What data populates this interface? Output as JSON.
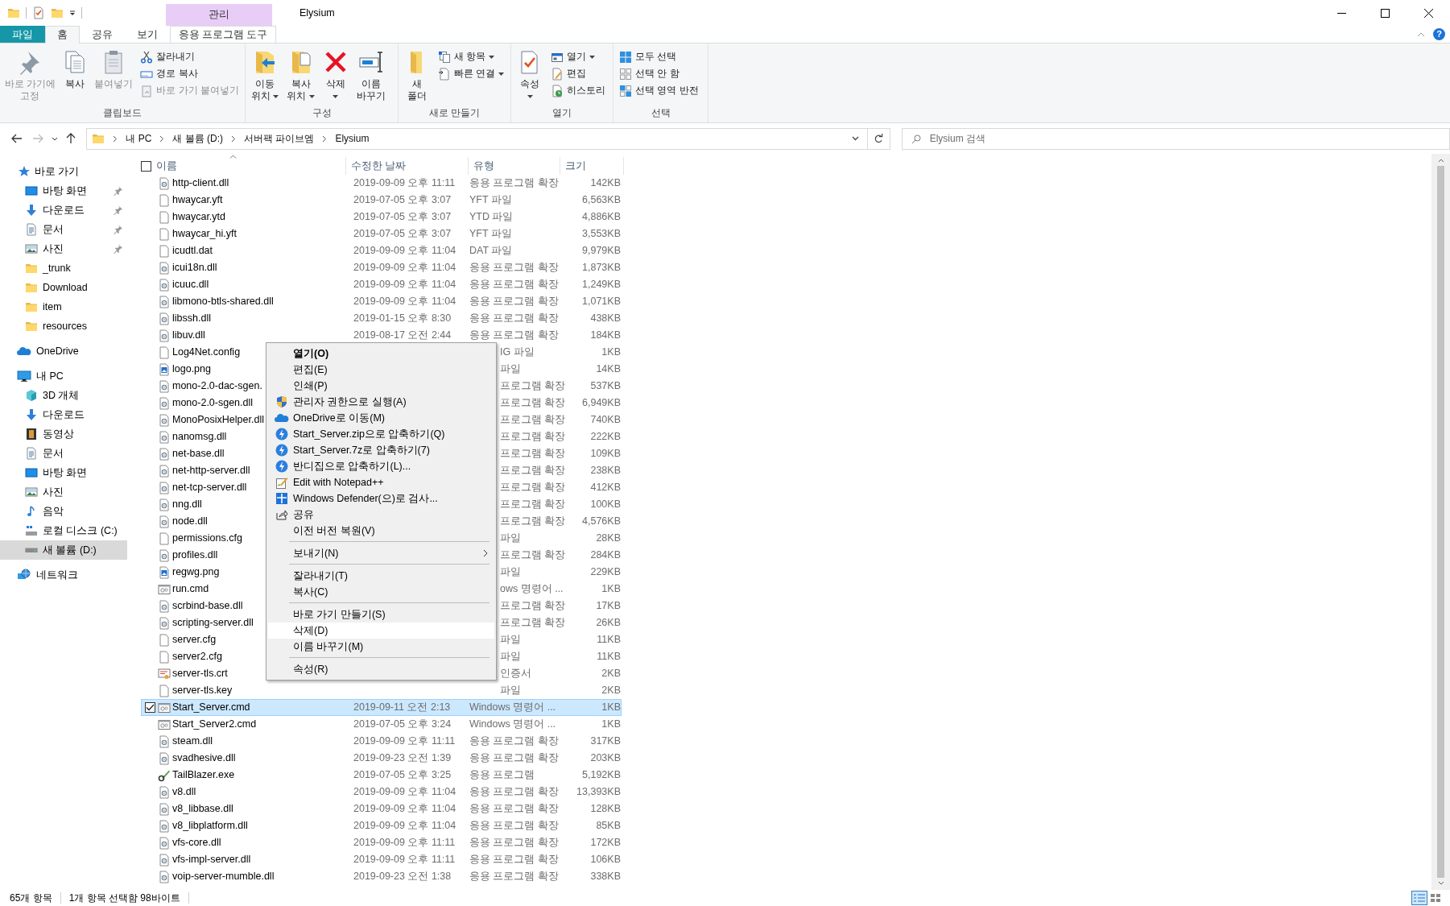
{
  "window": {
    "title": "Elysium",
    "context_group": "관리"
  },
  "ribbon_tabs": [
    {
      "label": "파일",
      "kind": "file",
      "selected": false
    },
    {
      "label": "홈",
      "kind": "tab",
      "selected": true
    },
    {
      "label": "공유",
      "kind": "tab",
      "selected": false
    },
    {
      "label": "보기",
      "kind": "tab",
      "selected": false
    },
    {
      "label": "응용 프로그램 도구",
      "kind": "context",
      "selected": false
    }
  ],
  "help": "?",
  "ribbon_groups": [
    {
      "label": "클립보드",
      "large": [
        {
          "lines": [
            "바로 가기에",
            "고정"
          ],
          "disabled": true,
          "dropdown": false
        },
        {
          "lines": [
            "복사"
          ],
          "disabled": false,
          "dropdown": false
        },
        {
          "lines": [
            "붙여넣기"
          ],
          "disabled": true,
          "dropdown": false
        }
      ],
      "small": [
        {
          "label": "잘라내기",
          "disabled": false,
          "dropdown": false
        },
        {
          "label": "경로 복사",
          "disabled": false,
          "dropdown": false
        },
        {
          "label": "바로 가기 붙여넣기",
          "disabled": true,
          "dropdown": false
        }
      ]
    },
    {
      "label": "구성",
      "large": [
        {
          "lines": [
            "이동",
            "위치"
          ],
          "disabled": false,
          "dropdown": true
        },
        {
          "lines": [
            "복사",
            "위치"
          ],
          "disabled": false,
          "dropdown": true
        },
        {
          "lines": [
            "삭제"
          ],
          "disabled": false,
          "dropdown": true
        },
        {
          "lines": [
            "이름",
            "바꾸기"
          ],
          "disabled": false,
          "dropdown": false
        }
      ]
    },
    {
      "label": "새로 만들기",
      "large": [
        {
          "lines": [
            "새",
            "폴더"
          ],
          "disabled": false,
          "dropdown": false
        }
      ],
      "small": [
        {
          "label": "새 항목",
          "disabled": false,
          "dropdown": true
        },
        {
          "label": "빠른 연결",
          "disabled": false,
          "dropdown": true
        }
      ]
    },
    {
      "label": "열기",
      "large": [
        {
          "lines": [
            "속성"
          ],
          "disabled": false,
          "dropdown": true
        }
      ],
      "small": [
        {
          "label": "열기",
          "disabled": false,
          "dropdown": true
        },
        {
          "label": "편집",
          "disabled": false,
          "dropdown": false
        },
        {
          "label": "히스토리",
          "disabled": false,
          "dropdown": false
        }
      ]
    },
    {
      "label": "선택",
      "small": [
        {
          "label": "모두 선택",
          "disabled": false,
          "dropdown": false
        },
        {
          "label": "선택 안 함",
          "disabled": false,
          "dropdown": false
        },
        {
          "label": "선택 영역 반전",
          "disabled": false,
          "dropdown": false
        }
      ]
    }
  ],
  "nav_buttons": [
    {
      "kind": "back",
      "disabled": false
    },
    {
      "kind": "forward",
      "disabled": true
    },
    {
      "kind": "recent",
      "disabled": false
    },
    {
      "kind": "up",
      "disabled": false
    }
  ],
  "address": {
    "crumbs": [
      "내 PC",
      "새 볼륨 (D:)",
      "서버팩 파이브엠",
      "Elysium"
    ]
  },
  "search": {
    "placeholder": "Elysium 검색"
  },
  "sidebar": [
    {
      "label": "바로 가기",
      "kind": "quick",
      "selected": false,
      "children": [
        {
          "label": "바탕 화면",
          "kind": "desktop",
          "selected": false,
          "pinned": true
        },
        {
          "label": "다운로드",
          "kind": "download",
          "selected": false,
          "pinned": true
        },
        {
          "label": "문서",
          "kind": "documents",
          "selected": false,
          "pinned": true
        },
        {
          "label": "사진",
          "kind": "pictures",
          "selected": false,
          "pinned": true
        },
        {
          "label": "_trunk",
          "kind": "folder",
          "selected": false,
          "pinned": false
        },
        {
          "label": "Download",
          "kind": "folder",
          "selected": false,
          "pinned": false
        },
        {
          "label": "item",
          "kind": "folder",
          "selected": false,
          "pinned": false
        },
        {
          "label": "resources",
          "kind": "folder",
          "selected": false,
          "pinned": false
        }
      ]
    },
    {
      "label": "OneDrive",
      "kind": "onedrive",
      "selected": false
    },
    {
      "label": "내 PC",
      "kind": "pc",
      "selected": false,
      "children": [
        {
          "label": "3D 개체",
          "kind": "objects3d",
          "selected": false
        },
        {
          "label": "다운로드",
          "kind": "download",
          "selected": false
        },
        {
          "label": "동영상",
          "kind": "videos",
          "selected": false
        },
        {
          "label": "문서",
          "kind": "documents",
          "selected": false
        },
        {
          "label": "바탕 화면",
          "kind": "desktop",
          "selected": false
        },
        {
          "label": "사진",
          "kind": "pictures",
          "selected": false
        },
        {
          "label": "음악",
          "kind": "music",
          "selected": false
        },
        {
          "label": "로컬 디스크 (C:)",
          "kind": "localdisk",
          "selected": false
        },
        {
          "label": "새 볼륨 (D:)",
          "kind": "drive",
          "selected": true
        }
      ]
    },
    {
      "label": "네트워크",
      "kind": "network",
      "selected": false
    }
  ],
  "select_all": {
    "checked": false
  },
  "columns": [
    {
      "label": "이름",
      "sorted": true
    },
    {
      "label": "수정한 날짜",
      "sorted": false
    },
    {
      "label": "유형",
      "sorted": false
    },
    {
      "label": "크기",
      "sorted": false
    }
  ],
  "files": [
    {
      "name": "http-client.dll",
      "kind": "dll",
      "date": "2019-09-09 오후 11:11",
      "type": "응용 프로그램 확장",
      "size": "142KB",
      "selected": false
    },
    {
      "name": "hwaycar.yft",
      "kind": "file",
      "date": "2019-07-05 오후 3:07",
      "type": "YFT 파일",
      "size": "6,563KB",
      "selected": false
    },
    {
      "name": "hwaycar.ytd",
      "kind": "file",
      "date": "2019-07-05 오후 3:07",
      "type": "YTD 파일",
      "size": "4,886KB",
      "selected": false
    },
    {
      "name": "hwaycar_hi.yft",
      "kind": "file",
      "date": "2019-07-05 오후 3:07",
      "type": "YFT 파일",
      "size": "3,553KB",
      "selected": false
    },
    {
      "name": "icudtl.dat",
      "kind": "file",
      "date": "2019-09-09 오후 11:04",
      "type": "DAT 파일",
      "size": "9,979KB",
      "selected": false
    },
    {
      "name": "icui18n.dll",
      "kind": "dll",
      "date": "2019-09-09 오후 11:04",
      "type": "응용 프로그램 확장",
      "size": "1,873KB",
      "selected": false
    },
    {
      "name": "icuuc.dll",
      "kind": "dll",
      "date": "2019-09-09 오후 11:04",
      "type": "응용 프로그램 확장",
      "size": "1,249KB",
      "selected": false
    },
    {
      "name": "libmono-btls-shared.dll",
      "kind": "dll",
      "date": "2019-09-09 오후 11:04",
      "type": "응용 프로그램 확장",
      "size": "1,071KB",
      "selected": false
    },
    {
      "name": "libssh.dll",
      "kind": "dll",
      "date": "2019-01-15 오후 8:30",
      "type": "응용 프로그램 확장",
      "size": "438KB",
      "selected": false
    },
    {
      "name": "libuv.dll",
      "kind": "dll",
      "date": "2019-08-17 오전 2:44",
      "type": "응용 프로그램 확장",
      "size": "184KB",
      "selected": false
    },
    {
      "name": "Log4Net.config",
      "kind": "file",
      "type": "IG 파일",
      "size": "1KB",
      "selected": false
    },
    {
      "name": "logo.png",
      "kind": "image",
      "type": "파일",
      "size": "14KB",
      "selected": false
    },
    {
      "name": "mono-2.0-dac-sgen.",
      "kind": "dll",
      "type": "프로그램 확장",
      "size": "537KB",
      "selected": false
    },
    {
      "name": "mono-2.0-sgen.dll",
      "kind": "dll",
      "type": "프로그램 확장",
      "size": "6,949KB",
      "selected": false
    },
    {
      "name": "MonoPosixHelper.dll",
      "kind": "dll",
      "type": "프로그램 확장",
      "size": "740KB",
      "selected": false
    },
    {
      "name": "nanomsg.dll",
      "kind": "dll",
      "type": "프로그램 확장",
      "size": "222KB",
      "selected": false
    },
    {
      "name": "net-base.dll",
      "kind": "dll",
      "type": "프로그램 확장",
      "size": "109KB",
      "selected": false
    },
    {
      "name": "net-http-server.dll",
      "kind": "dll",
      "type": "프로그램 확장",
      "size": "238KB",
      "selected": false
    },
    {
      "name": "net-tcp-server.dll",
      "kind": "dll",
      "type": "프로그램 확장",
      "size": "412KB",
      "selected": false
    },
    {
      "name": "nng.dll",
      "kind": "dll",
      "type": "프로그램 확장",
      "size": "100KB",
      "selected": false
    },
    {
      "name": "node.dll",
      "kind": "dll",
      "type": "프로그램 확장",
      "size": "4,576KB",
      "selected": false
    },
    {
      "name": "permissions.cfg",
      "kind": "file",
      "type": "파일",
      "size": "28KB",
      "selected": false
    },
    {
      "name": "profiles.dll",
      "kind": "dll",
      "type": "프로그램 확장",
      "size": "284KB",
      "selected": false
    },
    {
      "name": "regwg.png",
      "kind": "image",
      "type": "파일",
      "size": "229KB",
      "selected": false
    },
    {
      "name": "run.cmd",
      "kind": "cmd",
      "type": "ows 명령어 ...",
      "size": "1KB",
      "selected": false
    },
    {
      "name": "scrbind-base.dll",
      "kind": "dll",
      "type": "프로그램 확장",
      "size": "17KB",
      "selected": false
    },
    {
      "name": "scripting-server.dll",
      "kind": "dll",
      "type": "프로그램 확장",
      "size": "26KB",
      "selected": false
    },
    {
      "name": "server.cfg",
      "kind": "file",
      "type": "파일",
      "size": "11KB",
      "selected": false
    },
    {
      "name": "server2.cfg",
      "kind": "file",
      "type": "파일",
      "size": "11KB",
      "selected": false
    },
    {
      "name": "server-tls.crt",
      "kind": "cert",
      "type": "인증서",
      "size": "2KB",
      "selected": false
    },
    {
      "name": "server-tls.key",
      "kind": "file",
      "type": "파일",
      "size": "2KB",
      "selected": false
    },
    {
      "name": "Start_Server.cmd",
      "kind": "cmd",
      "date": "2019-09-11 오전 2:13",
      "type": "Windows 명령어 ...",
      "size": "1KB",
      "selected": true
    },
    {
      "name": "Start_Server2.cmd",
      "kind": "cmd",
      "date": "2019-07-05 오후 3:24",
      "type": "Windows 명령어 ...",
      "size": "1KB",
      "selected": false
    },
    {
      "name": "steam.dll",
      "kind": "dll",
      "date": "2019-09-09 오후 11:11",
      "type": "응용 프로그램 확장",
      "size": "317KB",
      "selected": false
    },
    {
      "name": "svadhesive.dll",
      "kind": "dll",
      "date": "2019-09-23 오전 1:39",
      "type": "응용 프로그램 확장",
      "size": "203KB",
      "selected": false
    },
    {
      "name": "TailBlazer.exe",
      "kind": "exe",
      "date": "2019-07-05 오후 3:25",
      "type": "응용 프로그램",
      "size": "5,192KB",
      "selected": false
    },
    {
      "name": "v8.dll",
      "kind": "dll",
      "date": "2019-09-09 오후 11:04",
      "type": "응용 프로그램 확장",
      "size": "13,393KB",
      "selected": false
    },
    {
      "name": "v8_libbase.dll",
      "kind": "dll",
      "date": "2019-09-09 오후 11:04",
      "type": "응용 프로그램 확장",
      "size": "128KB",
      "selected": false
    },
    {
      "name": "v8_libplatform.dll",
      "kind": "dll",
      "date": "2019-09-09 오후 11:04",
      "type": "응용 프로그램 확장",
      "size": "85KB",
      "selected": false
    },
    {
      "name": "vfs-core.dll",
      "kind": "dll",
      "date": "2019-09-09 오후 11:11",
      "type": "응용 프로그램 확장",
      "size": "172KB",
      "selected": false
    },
    {
      "name": "vfs-impl-server.dll",
      "kind": "dll",
      "date": "2019-09-09 오후 11:11",
      "type": "응용 프로그램 확장",
      "size": "106KB",
      "selected": false
    },
    {
      "name": "voip-server-mumble.dll",
      "kind": "dll",
      "date": "2019-09-23 오전 1:38",
      "type": "응용 프로그램 확장",
      "size": "338KB",
      "selected": false
    }
  ],
  "context_menu": {
    "sections": [
      [
        {
          "label": "열기(O)",
          "default": true,
          "submenu": false,
          "selected": false
        },
        {
          "label": "편집(E)",
          "default": false,
          "submenu": false,
          "selected": false
        },
        {
          "label": "인쇄(P)",
          "default": false,
          "submenu": false,
          "selected": false
        },
        {
          "label": "관리자 권한으로 실행(A)",
          "default": false,
          "submenu": false,
          "selected": false
        },
        {
          "label": "OneDrive로 이동(M)",
          "default": false,
          "submenu": false,
          "selected": false
        },
        {
          "label": "Start_Server.zip으로 압축하기(Q)",
          "default": false,
          "submenu": false,
          "selected": false
        },
        {
          "label": "Start_Server.7z로 압축하기(7)",
          "default": false,
          "submenu": false,
          "selected": false
        },
        {
          "label": "반디집으로 압축하기(L)...",
          "default": false,
          "submenu": false,
          "selected": false
        },
        {
          "label": "Edit with Notepad++",
          "default": false,
          "submenu": false,
          "selected": false
        },
        {
          "label": "Windows Defender(으)로 검사...",
          "default": false,
          "submenu": false,
          "selected": false
        },
        {
          "label": "공유",
          "default": false,
          "submenu": false,
          "selected": false
        },
        {
          "label": "이전 버전 복원(V)",
          "default": false,
          "submenu": false,
          "selected": false
        }
      ],
      [
        {
          "label": "보내기(N)",
          "default": false,
          "submenu": true,
          "selected": false
        }
      ],
      [
        {
          "label": "잘라내기(T)",
          "default": false,
          "submenu": false,
          "selected": false
        },
        {
          "label": "복사(C)",
          "default": false,
          "submenu": false,
          "selected": false
        }
      ],
      [
        {
          "label": "바로 가기 만들기(S)",
          "default": false,
          "submenu": false,
          "selected": false
        },
        {
          "label": "삭제(D)",
          "default": false,
          "submenu": false,
          "selected": true
        },
        {
          "label": "이름 바꾸기(M)",
          "default": false,
          "submenu": false,
          "selected": false
        }
      ],
      [
        {
          "label": "속성(R)",
          "default": false,
          "submenu": false,
          "selected": false
        }
      ]
    ]
  },
  "status_bar": {
    "count": "65개 항목",
    "selection": "1개 항목 선택함 98바이트",
    "views": [
      {
        "kind": "details",
        "selected": true
      },
      {
        "kind": "icons",
        "selected": false
      }
    ]
  }
}
